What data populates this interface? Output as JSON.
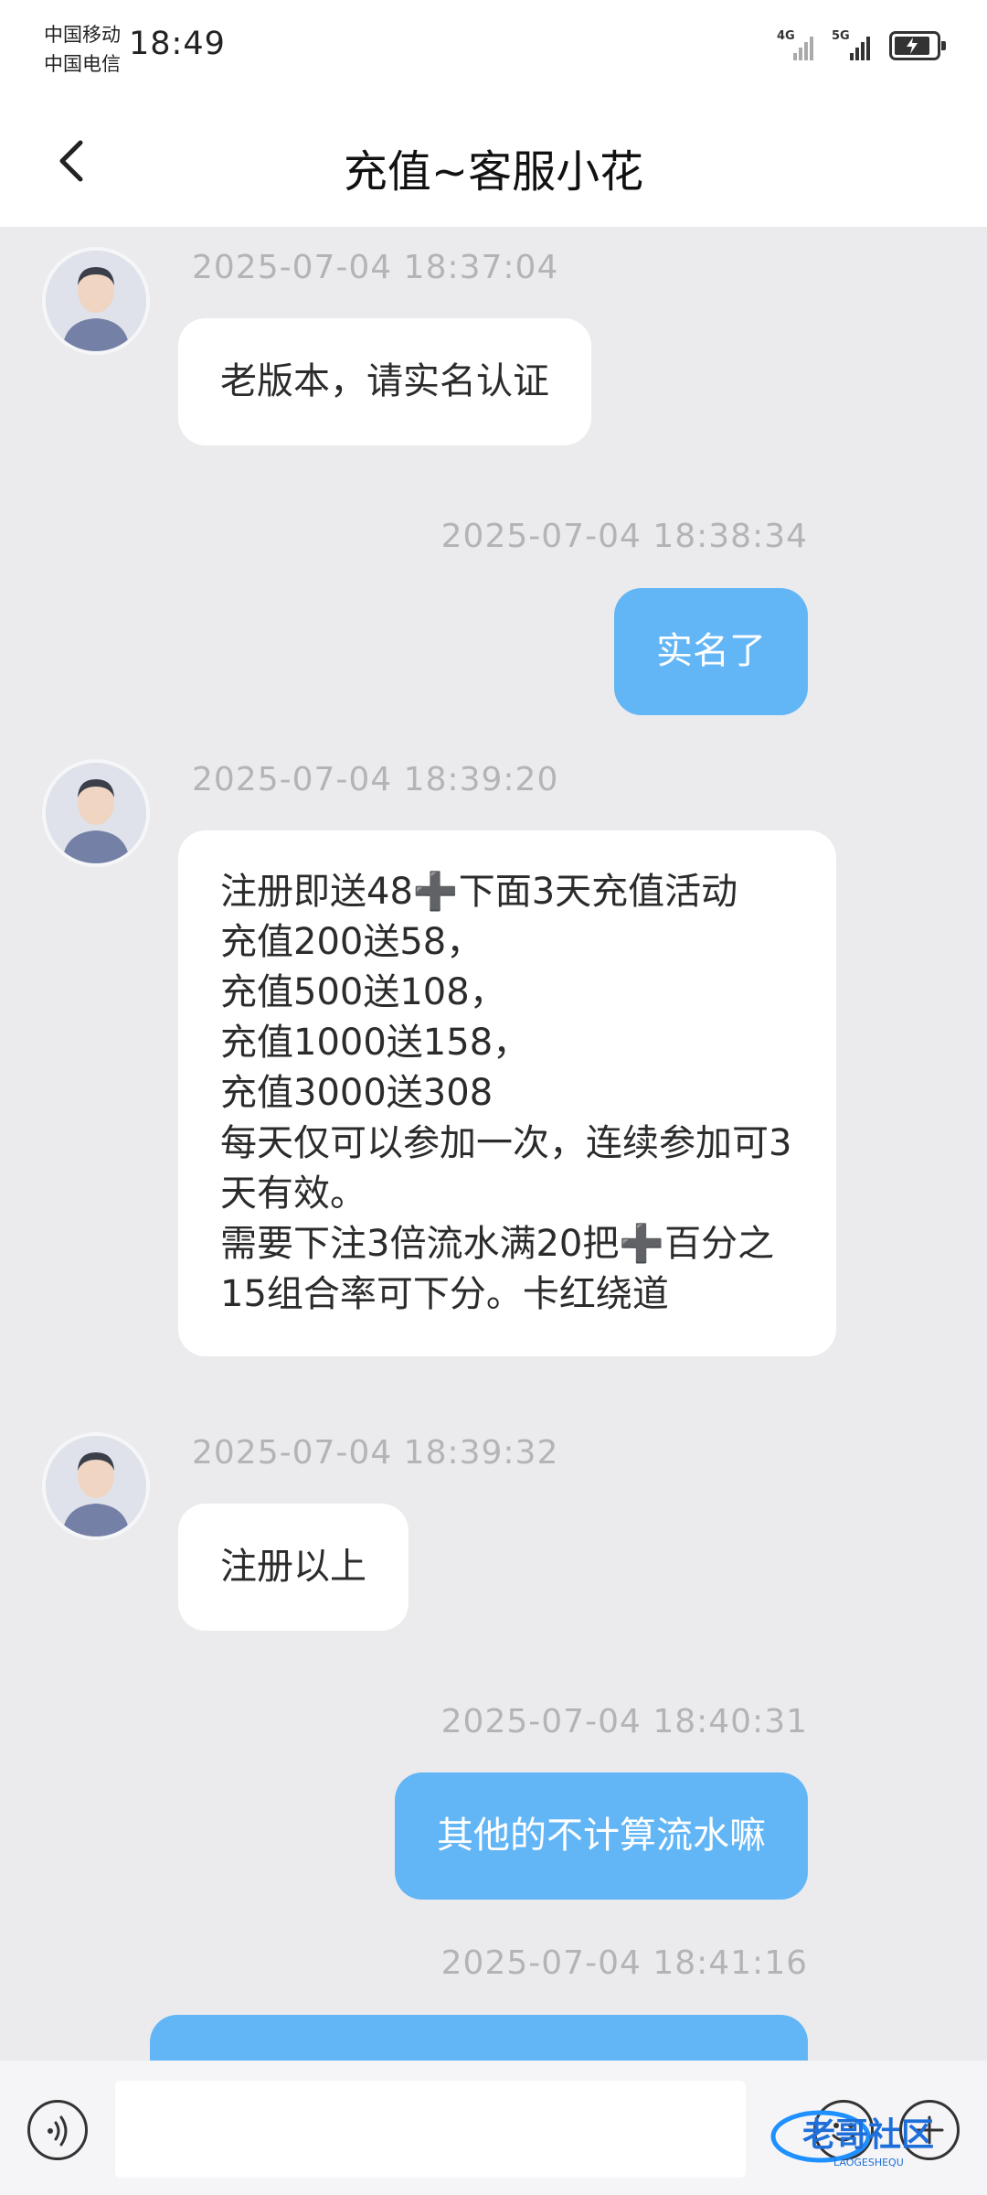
{
  "status_bar": {
    "carrier_1": "中国移动",
    "carrier_2": "中国电信",
    "time": "18:49",
    "signal_1_label": "4G",
    "signal_2_label": "5G",
    "icons": [
      "signal-icon",
      "signal-icon",
      "battery-icon"
    ]
  },
  "header": {
    "title": "充值~客服小花",
    "back_icon": "chevron-left-icon"
  },
  "messages": [
    {
      "side": "in",
      "timestamp": "2025-07-04 18:37:04",
      "text": "老版本，请实名认证"
    },
    {
      "side": "out",
      "timestamp": "2025-07-04 18:38:34",
      "text": "实名了"
    },
    {
      "side": "in",
      "timestamp": "2025-07-04 18:39:20",
      "text": "注册即送48➕下面3天充值活动\n充值200送58，\n充值500送108，\n充值1000送158，\n充值3000送308\n每天仅可以参加一次，连续参加可3天有效。\n需要下注3倍流水满20把➕百分之15组合率可下分。卡红绕道"
    },
    {
      "side": "in",
      "timestamp": "2025-07-04 18:39:32",
      "text": "注册以上"
    },
    {
      "side": "out",
      "timestamp": "2025-07-04 18:40:31",
      "text": "其他的不计算流水嘛"
    },
    {
      "side": "out",
      "timestamp": "2025-07-04 18:41:16",
      "text": ""
    }
  ],
  "input_bar": {
    "placeholder": "",
    "icons": [
      "voice-icon",
      "emoji-icon",
      "plus-icon"
    ]
  },
  "watermark": {
    "text": "老哥社区",
    "subtext": "LAOGESHEQU"
  },
  "colors": {
    "background": "#ebebed",
    "incoming_bubble": "#ffffff",
    "outgoing_bubble": "#63b6f6",
    "timestamp": "#b4b4b8"
  }
}
